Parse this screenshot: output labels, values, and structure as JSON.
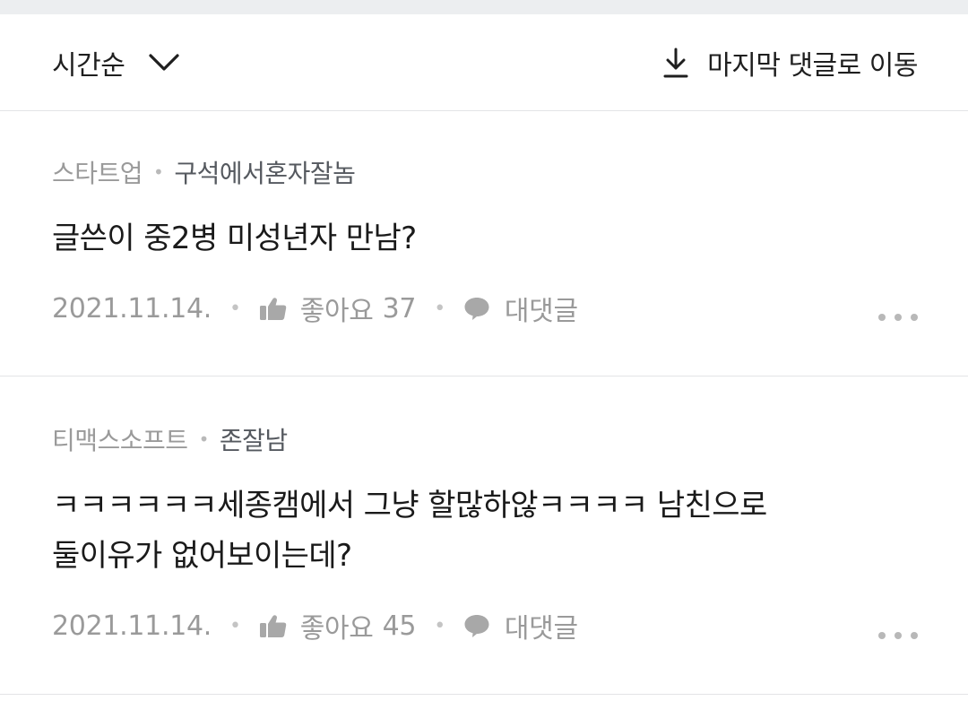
{
  "sort_bar": {
    "sort_label": "시간순",
    "jump_label": "마지막 댓글로 이동"
  },
  "comments": [
    {
      "company": "스타트업",
      "nickname": "구석에서혼자잘놈",
      "text": "글쓴이 중2병 미성년자 만남?",
      "date": "2021.11.14.",
      "like_label": "좋아요",
      "like_count": "37",
      "reply_label": "대댓글"
    },
    {
      "company": "티맥스소프트",
      "nickname": "존잘남",
      "text": "ㅋㅋㅋㅋㅋㅋ세종캠에서 그냥 할많하않ㅋㅋㅋㅋ 남친으로\n둘이유가 없어보이는데?",
      "date": "2021.11.14.",
      "like_label": "좋아요",
      "like_count": "45",
      "reply_label": "대댓글"
    }
  ]
}
